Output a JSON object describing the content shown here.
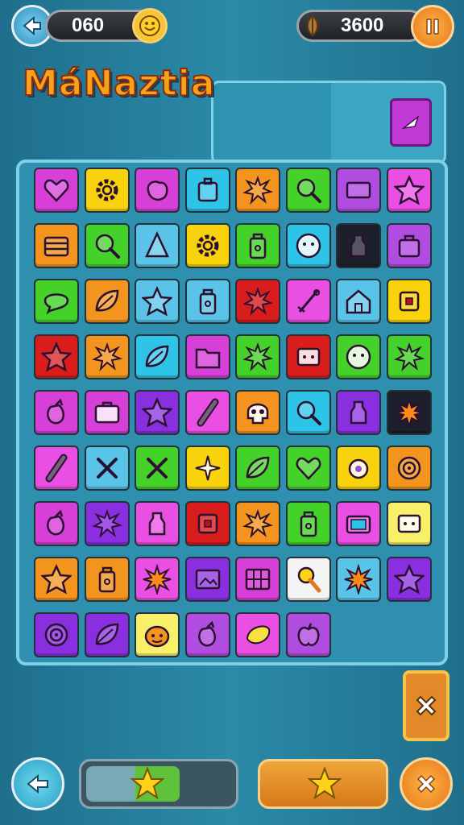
{
  "hud": {
    "left_counter": "060",
    "right_counter": "3600"
  },
  "title": "MáNaztia",
  "colors": {
    "purple": "#b14ce0",
    "yellow": "#f7d20d",
    "magenta": "#d63fd8",
    "cyan": "#2ec4e8",
    "orange": "#f2941e",
    "green": "#44d12a",
    "violet": "#8a2fe0",
    "red": "#d91d1d",
    "lightblue": "#59c4e8",
    "black": "#1d1f2b",
    "white": "#f4f4f4",
    "pink": "#e84fe2",
    "lightyellow": "#f9f06a"
  },
  "board": {
    "rows": [
      [
        [
          "magenta",
          "heart-icon"
        ],
        [
          "yellow",
          "gear-icon"
        ],
        [
          "magenta",
          "blob-icon"
        ],
        [
          "cyan",
          "box-icon"
        ],
        [
          "orange",
          "splat-icon"
        ],
        [
          "green",
          "magnifier-icon"
        ],
        [
          "purple",
          "rectangle-icon"
        ],
        [
          "pink",
          "star-icon"
        ]
      ],
      [
        [
          "orange",
          "chest-icon"
        ],
        [
          "green",
          "magnifier-icon"
        ],
        [
          "lightblue",
          "cone-icon"
        ],
        [
          "yellow",
          "gear-icon"
        ],
        [
          "green",
          "jar-icon"
        ],
        [
          "cyan",
          "face-icon"
        ],
        [
          "black",
          "bottle-icon"
        ],
        [
          "purple",
          "bag-icon"
        ]
      ],
      [
        [
          "green",
          "speech-bubble-icon"
        ],
        [
          "orange",
          "leaf-icon"
        ],
        [
          "lightblue",
          "star-icon"
        ],
        [
          "lightblue",
          "jar-icon"
        ],
        [
          "red",
          "splat-icon"
        ],
        [
          "pink",
          "needle-icon"
        ],
        [
          "lightblue",
          "house-icon"
        ],
        [
          "yellow",
          "square-target-icon"
        ]
      ],
      [
        [
          "red",
          "star-icon"
        ],
        [
          "orange",
          "splat-icon"
        ],
        [
          "cyan",
          "leaf-icon"
        ],
        [
          "magenta",
          "folder-icon"
        ],
        [
          "green",
          "splat-icon"
        ],
        [
          "red",
          "face-box-icon"
        ],
        [
          "green",
          "face-icon"
        ],
        [
          "green",
          "splat-icon"
        ]
      ],
      [
        [
          "magenta",
          "eggplant-icon"
        ],
        [
          "magenta",
          "suitcase-icon"
        ],
        [
          "violet",
          "star-icon"
        ],
        [
          "pink",
          "stick-icon"
        ],
        [
          "orange",
          "skull-icon"
        ],
        [
          "cyan",
          "magnifier-icon"
        ],
        [
          "violet",
          "bottle-icon"
        ],
        [
          "black",
          "burst-icon"
        ]
      ],
      [
        [
          "pink",
          "stick-icon"
        ],
        [
          "lightblue",
          "cross-tools-icon"
        ],
        [
          "green",
          "cross-tools-icon"
        ],
        [
          "yellow",
          "sparkle-icon"
        ],
        [
          "green",
          "leaf-icon"
        ],
        [
          "green",
          "heart-icon"
        ],
        [
          "yellow",
          "ring-icon"
        ],
        [
          "orange",
          "spiral-icon"
        ]
      ],
      [
        [
          "magenta",
          "eggplant-icon"
        ],
        [
          "violet",
          "splat-icon"
        ],
        [
          "pink",
          "bottle-icon"
        ],
        [
          "red",
          "square-target-icon"
        ],
        [
          "orange",
          "splat-icon"
        ],
        [
          "green",
          "jar-icon"
        ],
        [
          "pink",
          "tv-icon"
        ],
        [
          "lightyellow",
          "face-box-icon"
        ]
      ],
      [
        [
          "orange",
          "star-icon"
        ],
        [
          "orange",
          "jar-icon"
        ],
        [
          "pink",
          "burst-icon"
        ],
        [
          "violet",
          "picture-icon"
        ],
        [
          "magenta",
          "grid-icon"
        ],
        [
          "white",
          "lollipop-icon"
        ],
        [
          "lightblue",
          "burst-icon"
        ],
        [
          "violet",
          "star-icon"
        ]
      ],
      [
        [
          "violet",
          "spiral-icon"
        ],
        [
          "violet",
          "leaf-icon"
        ],
        [
          "lightyellow",
          "pumpkin-icon"
        ],
        [
          "purple",
          "eggplant-icon"
        ],
        [
          "pink",
          "lemon-icon"
        ],
        [
          "purple",
          "apple-icon"
        ]
      ]
    ]
  }
}
